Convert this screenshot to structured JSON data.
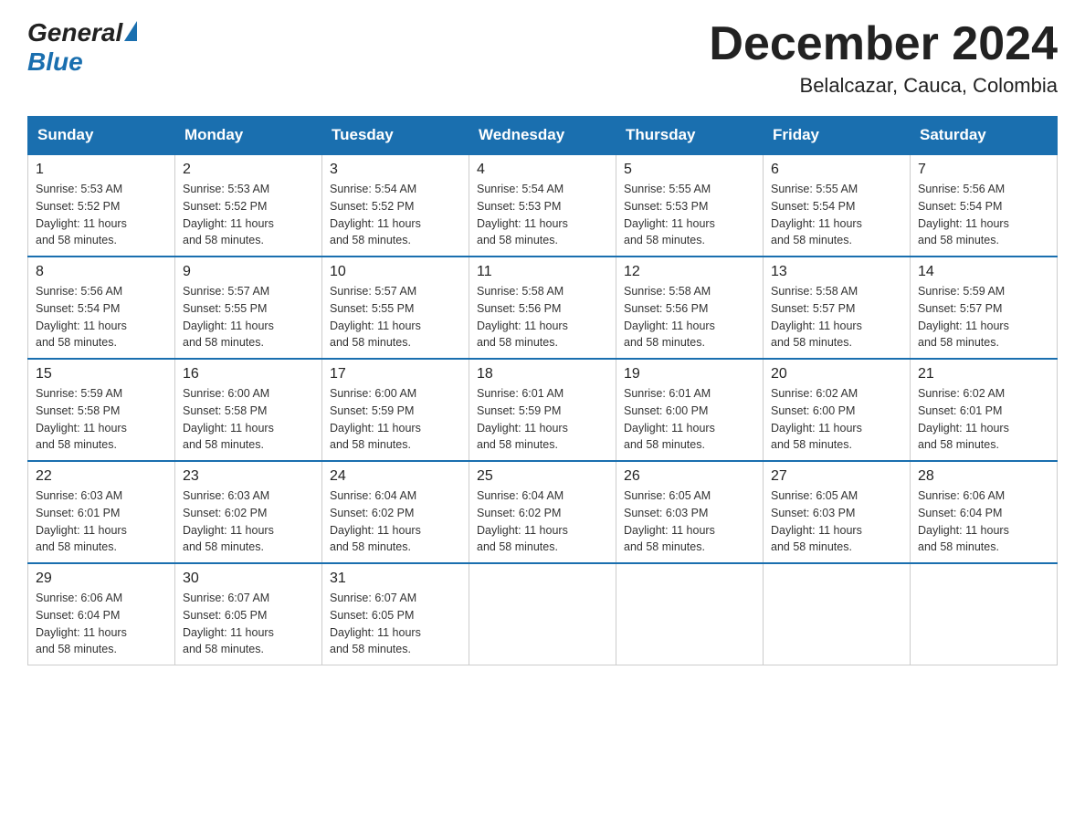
{
  "logo": {
    "general": "General",
    "blue": "Blue",
    "tagline": ""
  },
  "title": {
    "month_year": "December 2024",
    "location": "Belalcazar, Cauca, Colombia"
  },
  "days_of_week": [
    "Sunday",
    "Monday",
    "Tuesday",
    "Wednesday",
    "Thursday",
    "Friday",
    "Saturday"
  ],
  "weeks": [
    [
      {
        "day": "1",
        "sunrise": "5:53 AM",
        "sunset": "5:52 PM",
        "daylight": "11 hours and 58 minutes."
      },
      {
        "day": "2",
        "sunrise": "5:53 AM",
        "sunset": "5:52 PM",
        "daylight": "11 hours and 58 minutes."
      },
      {
        "day": "3",
        "sunrise": "5:54 AM",
        "sunset": "5:52 PM",
        "daylight": "11 hours and 58 minutes."
      },
      {
        "day": "4",
        "sunrise": "5:54 AM",
        "sunset": "5:53 PM",
        "daylight": "11 hours and 58 minutes."
      },
      {
        "day": "5",
        "sunrise": "5:55 AM",
        "sunset": "5:53 PM",
        "daylight": "11 hours and 58 minutes."
      },
      {
        "day": "6",
        "sunrise": "5:55 AM",
        "sunset": "5:54 PM",
        "daylight": "11 hours and 58 minutes."
      },
      {
        "day": "7",
        "sunrise": "5:56 AM",
        "sunset": "5:54 PM",
        "daylight": "11 hours and 58 minutes."
      }
    ],
    [
      {
        "day": "8",
        "sunrise": "5:56 AM",
        "sunset": "5:54 PM",
        "daylight": "11 hours and 58 minutes."
      },
      {
        "day": "9",
        "sunrise": "5:57 AM",
        "sunset": "5:55 PM",
        "daylight": "11 hours and 58 minutes."
      },
      {
        "day": "10",
        "sunrise": "5:57 AM",
        "sunset": "5:55 PM",
        "daylight": "11 hours and 58 minutes."
      },
      {
        "day": "11",
        "sunrise": "5:58 AM",
        "sunset": "5:56 PM",
        "daylight": "11 hours and 58 minutes."
      },
      {
        "day": "12",
        "sunrise": "5:58 AM",
        "sunset": "5:56 PM",
        "daylight": "11 hours and 58 minutes."
      },
      {
        "day": "13",
        "sunrise": "5:58 AM",
        "sunset": "5:57 PM",
        "daylight": "11 hours and 58 minutes."
      },
      {
        "day": "14",
        "sunrise": "5:59 AM",
        "sunset": "5:57 PM",
        "daylight": "11 hours and 58 minutes."
      }
    ],
    [
      {
        "day": "15",
        "sunrise": "5:59 AM",
        "sunset": "5:58 PM",
        "daylight": "11 hours and 58 minutes."
      },
      {
        "day": "16",
        "sunrise": "6:00 AM",
        "sunset": "5:58 PM",
        "daylight": "11 hours and 58 minutes."
      },
      {
        "day": "17",
        "sunrise": "6:00 AM",
        "sunset": "5:59 PM",
        "daylight": "11 hours and 58 minutes."
      },
      {
        "day": "18",
        "sunrise": "6:01 AM",
        "sunset": "5:59 PM",
        "daylight": "11 hours and 58 minutes."
      },
      {
        "day": "19",
        "sunrise": "6:01 AM",
        "sunset": "6:00 PM",
        "daylight": "11 hours and 58 minutes."
      },
      {
        "day": "20",
        "sunrise": "6:02 AM",
        "sunset": "6:00 PM",
        "daylight": "11 hours and 58 minutes."
      },
      {
        "day": "21",
        "sunrise": "6:02 AM",
        "sunset": "6:01 PM",
        "daylight": "11 hours and 58 minutes."
      }
    ],
    [
      {
        "day": "22",
        "sunrise": "6:03 AM",
        "sunset": "6:01 PM",
        "daylight": "11 hours and 58 minutes."
      },
      {
        "day": "23",
        "sunrise": "6:03 AM",
        "sunset": "6:02 PM",
        "daylight": "11 hours and 58 minutes."
      },
      {
        "day": "24",
        "sunrise": "6:04 AM",
        "sunset": "6:02 PM",
        "daylight": "11 hours and 58 minutes."
      },
      {
        "day": "25",
        "sunrise": "6:04 AM",
        "sunset": "6:02 PM",
        "daylight": "11 hours and 58 minutes."
      },
      {
        "day": "26",
        "sunrise": "6:05 AM",
        "sunset": "6:03 PM",
        "daylight": "11 hours and 58 minutes."
      },
      {
        "day": "27",
        "sunrise": "6:05 AM",
        "sunset": "6:03 PM",
        "daylight": "11 hours and 58 minutes."
      },
      {
        "day": "28",
        "sunrise": "6:06 AM",
        "sunset": "6:04 PM",
        "daylight": "11 hours and 58 minutes."
      }
    ],
    [
      {
        "day": "29",
        "sunrise": "6:06 AM",
        "sunset": "6:04 PM",
        "daylight": "11 hours and 58 minutes."
      },
      {
        "day": "30",
        "sunrise": "6:07 AM",
        "sunset": "6:05 PM",
        "daylight": "11 hours and 58 minutes."
      },
      {
        "day": "31",
        "sunrise": "6:07 AM",
        "sunset": "6:05 PM",
        "daylight": "11 hours and 58 minutes."
      },
      null,
      null,
      null,
      null
    ]
  ],
  "labels": {
    "sunrise": "Sunrise:",
    "sunset": "Sunset:",
    "daylight": "Daylight:"
  }
}
